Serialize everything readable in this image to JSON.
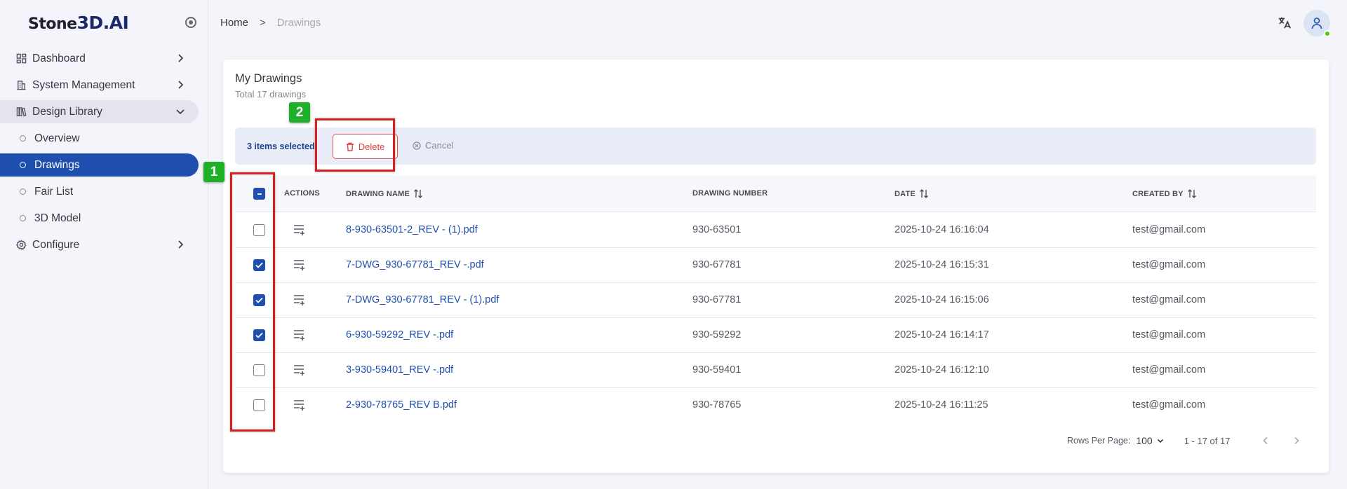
{
  "brand": {
    "name_part1": "Stone",
    "name_part2": "3D.AI"
  },
  "sidebar": {
    "items": [
      {
        "label": "Dashboard",
        "icon": "dashboard-icon"
      },
      {
        "label": "System Management",
        "icon": "building-icon"
      },
      {
        "label": "Design Library",
        "icon": "library-icon",
        "expanded": true,
        "children": [
          {
            "label": "Overview"
          },
          {
            "label": "Drawings",
            "active": true
          },
          {
            "label": "Fair List"
          },
          {
            "label": "3D Model"
          }
        ]
      },
      {
        "label": "Configure",
        "icon": "gear-icon"
      }
    ]
  },
  "breadcrumb": {
    "home": "Home",
    "separator": ">",
    "current": "Drawings"
  },
  "card": {
    "title": "My Drawings",
    "subtitle": "Total 17 drawings"
  },
  "selection": {
    "text": "3 items selected",
    "delete_label": "Delete",
    "cancel_label": "Cancel"
  },
  "table": {
    "headers": {
      "actions": "ACTIONS",
      "drawing_name": "DRAWING NAME",
      "drawing_number": "DRAWING NUMBER",
      "date": "DATE",
      "created_by": "CREATED BY"
    },
    "rows": [
      {
        "name": "8-930-63501-2_REV - (1).pdf",
        "number": "930-63501",
        "date": "2025-10-24 16:16:04",
        "created_by": "test@gmail.com",
        "checked": false
      },
      {
        "name": "7-DWG_930-67781_REV -.pdf",
        "number": "930-67781",
        "date": "2025-10-24 16:15:31",
        "created_by": "test@gmail.com",
        "checked": true
      },
      {
        "name": "7-DWG_930-67781_REV - (1).pdf",
        "number": "930-67781",
        "date": "2025-10-24 16:15:06",
        "created_by": "test@gmail.com",
        "checked": true
      },
      {
        "name": "6-930-59292_REV -.pdf",
        "number": "930-59292",
        "date": "2025-10-24 16:14:17",
        "created_by": "test@gmail.com",
        "checked": true
      },
      {
        "name": "3-930-59401_REV -.pdf",
        "number": "930-59401",
        "date": "2025-10-24 16:12:10",
        "created_by": "test@gmail.com",
        "checked": false
      },
      {
        "name": "2-930-78765_REV B.pdf",
        "number": "930-78765",
        "date": "2025-10-24 16:11:25",
        "created_by": "test@gmail.com",
        "checked": false
      }
    ]
  },
  "pagination": {
    "rows_per_page_label": "Rows Per Page:",
    "rows_per_page": "100",
    "range": "1 - 17 of 17"
  },
  "annotations": {
    "badge1": "1",
    "badge2": "2"
  },
  "colors": {
    "primary": "#1f4fae",
    "danger": "#e04040",
    "annotation_box": "#d71f1f",
    "annotation_badge": "#1fb02a"
  }
}
